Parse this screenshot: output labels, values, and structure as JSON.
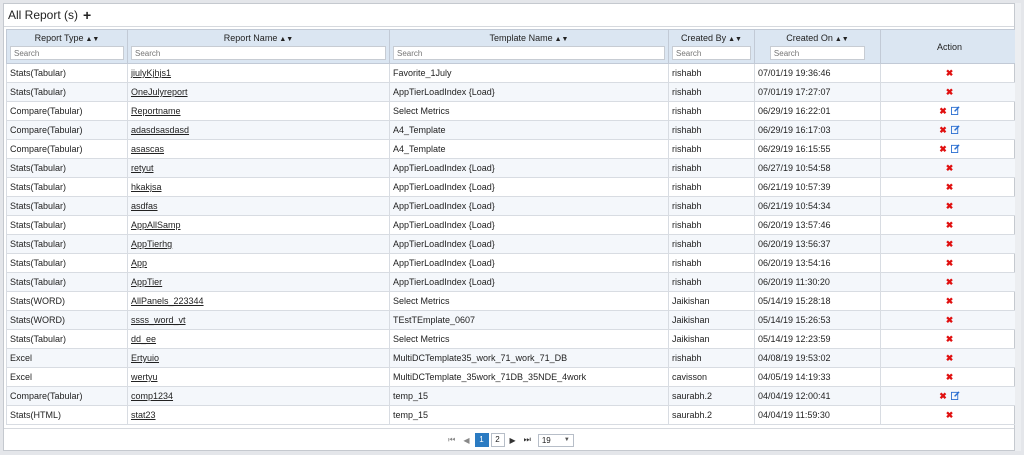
{
  "header": {
    "title": "All Report (s)",
    "add_icon": "+"
  },
  "columns": [
    {
      "label": "Report Type",
      "sort_icon": "▲▼",
      "placeholder": "Search"
    },
    {
      "label": "Report Name",
      "sort_icon": "▲▼",
      "placeholder": "Search"
    },
    {
      "label": "Template Name",
      "sort_icon": "▲▼",
      "placeholder": "Search"
    },
    {
      "label": "Created By",
      "sort_icon": "▲▼",
      "placeholder": "Search"
    },
    {
      "label": "Created On",
      "sort_icon": "▲▼",
      "placeholder": "Search"
    },
    {
      "label": "Action"
    }
  ],
  "rows": [
    {
      "type": "Stats(Tabular)",
      "name": "jiulyKjhjs1",
      "template": "Favorite_1July",
      "by": "rishabh",
      "on": "07/01/19 19:36:46",
      "editable": false
    },
    {
      "type": "Stats(Tabular)",
      "name": "OneJulyreport",
      "template": "AppTierLoadIndex {Load}",
      "by": "rishabh",
      "on": "07/01/19 17:27:07",
      "editable": false
    },
    {
      "type": "Compare(Tabular)",
      "name": "Reportname",
      "template": "Select Metrics",
      "by": "rishabh",
      "on": "06/29/19 16:22:01",
      "editable": true
    },
    {
      "type": "Compare(Tabular)",
      "name": "adasdsasdasd",
      "template": "A4_Template",
      "by": "rishabh",
      "on": "06/29/19 16:17:03",
      "editable": true
    },
    {
      "type": "Compare(Tabular)",
      "name": "asascas",
      "template": "A4_Template",
      "by": "rishabh",
      "on": "06/29/19 16:15:55",
      "editable": true
    },
    {
      "type": "Stats(Tabular)",
      "name": "retyut",
      "template": "AppTierLoadIndex {Load}",
      "by": "rishabh",
      "on": "06/27/19 10:54:58",
      "editable": false
    },
    {
      "type": "Stats(Tabular)",
      "name": "hkakjsa",
      "template": "AppTierLoadIndex {Load}",
      "by": "rishabh",
      "on": "06/21/19 10:57:39",
      "editable": false
    },
    {
      "type": "Stats(Tabular)",
      "name": "asdfas",
      "template": "AppTierLoadIndex {Load}",
      "by": "rishabh",
      "on": "06/21/19 10:54:34",
      "editable": false
    },
    {
      "type": "Stats(Tabular)",
      "name": "AppAllSamp",
      "template": "AppTierLoadIndex {Load}",
      "by": "rishabh",
      "on": "06/20/19 13:57:46",
      "editable": false
    },
    {
      "type": "Stats(Tabular)",
      "name": "AppTierhg",
      "template": "AppTierLoadIndex {Load}",
      "by": "rishabh",
      "on": "06/20/19 13:56:37",
      "editable": false
    },
    {
      "type": "Stats(Tabular)",
      "name": "App",
      "template": "AppTierLoadIndex {Load}",
      "by": "rishabh",
      "on": "06/20/19 13:54:16",
      "editable": false
    },
    {
      "type": "Stats(Tabular)",
      "name": "AppTier",
      "template": "AppTierLoadIndex {Load}",
      "by": "rishabh",
      "on": "06/20/19 11:30:20",
      "editable": false
    },
    {
      "type": "Stats(WORD)",
      "name": "AllPanels_223344",
      "template": "Select Metrics",
      "by": "Jaikishan",
      "on": "05/14/19 15:28:18",
      "editable": false
    },
    {
      "type": "Stats(WORD)",
      "name": "ssss_word_vt",
      "template": "TEstTEmplate_0607",
      "by": "Jaikishan",
      "on": "05/14/19 15:26:53",
      "editable": false
    },
    {
      "type": "Stats(Tabular)",
      "name": "dd_ee",
      "template": "Select Metrics",
      "by": "Jaikishan",
      "on": "05/14/19 12:23:59",
      "editable": false
    },
    {
      "type": "Excel",
      "name": "Ertyuio",
      "template": "MultiDCTemplate35_work_71_work_71_DB",
      "by": "rishabh",
      "on": "04/08/19 19:53:02",
      "editable": false
    },
    {
      "type": "Excel",
      "name": "wertyu",
      "template": "MultiDCTemplate_35work_71DB_35NDE_4work",
      "by": "cavisson",
      "on": "04/05/19 14:19:33",
      "editable": false
    },
    {
      "type": "Compare(Tabular)",
      "name": "comp1234",
      "template": "temp_15",
      "by": "saurabh.2",
      "on": "04/04/19 12:00:41",
      "editable": true
    },
    {
      "type": "Stats(HTML)",
      "name": "stat23",
      "template": "temp_15",
      "by": "saurabh.2",
      "on": "04/04/19 11:59:30",
      "editable": false
    }
  ],
  "icons": {
    "delete": "✖",
    "edit": "edit-icon"
  },
  "pagination": {
    "first": "⏮",
    "prev": "◀",
    "next": "▶",
    "last": "⏭",
    "pages": [
      "1",
      "2"
    ],
    "current": "1",
    "page_size": "19",
    "dropdown": "▼"
  },
  "colors": {
    "header_bg": "#dbe6f2",
    "delete": "#e01010",
    "active_page": "#2b7bc2",
    "edit": "#2b6fd1"
  }
}
